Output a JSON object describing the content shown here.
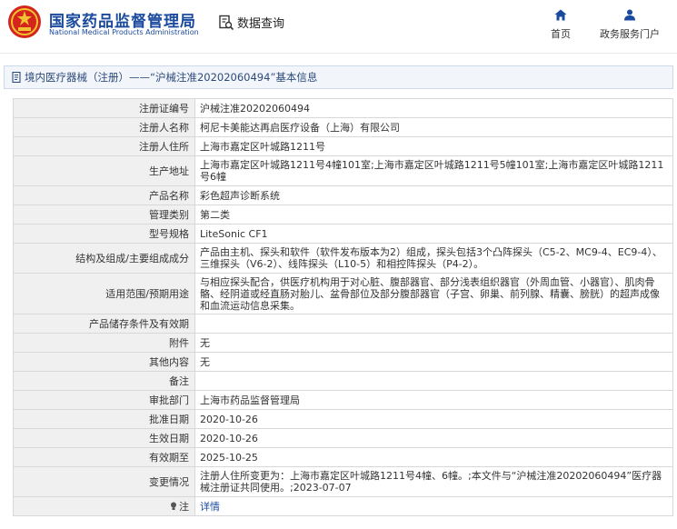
{
  "header": {
    "site_name_cn": "国家药品监督管理局",
    "site_name_en": "National Medical Products Administration",
    "query_label": "数据查询",
    "nav_home": "首页",
    "nav_services": "政务服务门户",
    "brand_color": "#1a4a9e"
  },
  "page": {
    "title": "境内医疗器械（注册）——“沪械注准20202060494”基本信息"
  },
  "rows": [
    {
      "key": "注册证编号",
      "value": "沪械注准20202060494"
    },
    {
      "key": "注册人名称",
      "value": "柯尼卡美能达再启医疗设备（上海）有限公司"
    },
    {
      "key": "注册人住所",
      "value": "上海市嘉定区叶城路1211号"
    },
    {
      "key": "生产地址",
      "value": "上海市嘉定区叶城路1211号4幢101室;上海市嘉定区叶城路1211号5幢101室;上海市嘉定区叶城路1211号6幢"
    },
    {
      "key": "产品名称",
      "value": "彩色超声诊断系统"
    },
    {
      "key": "管理类别",
      "value": "第二类"
    },
    {
      "key": "型号规格",
      "value": "LiteSonic CF1"
    },
    {
      "key": "结构及组成/主要组成成分",
      "value": "产品由主机、探头和软件（软件发布版本为2）组成，探头包括3个凸阵探头（C5-2、MC9-4、EC9-4）、三维探头（V6-2）、线阵探头（L10-5）和相控阵探头（P4-2）。"
    },
    {
      "key": "适用范围/预期用途",
      "value": "与相应探头配合，供医疗机构用于对心脏、腹部器官、部分浅表组织器官（外周血管、小器官）、肌肉骨骼、经阴道或经直肠对胎儿、盆骨部位及部分腹部器官（子宫、卵巢、前列腺、精囊、膀胱）的超声成像和血流运动信息采集。"
    },
    {
      "key": "产品储存条件及有效期",
      "value": ""
    },
    {
      "key": "附件",
      "value": "无"
    },
    {
      "key": "其他内容",
      "value": "无"
    },
    {
      "key": "备注",
      "value": ""
    },
    {
      "key": "审批部门",
      "value": "上海市药品监督管理局"
    },
    {
      "key": "批准日期",
      "value": "2020-10-26"
    },
    {
      "key": "生效日期",
      "value": "2020-10-26"
    },
    {
      "key": "有效期至",
      "value": "2025-10-25"
    },
    {
      "key": "变更情况",
      "value": "注册人住所变更为：上海市嘉定区叶城路1211号4幢、6幢。;本文件与“沪械注准20202060494”医疗器械注册证共同使用。;2023-07-07"
    },
    {
      "key": "注",
      "value": "详情"
    }
  ]
}
